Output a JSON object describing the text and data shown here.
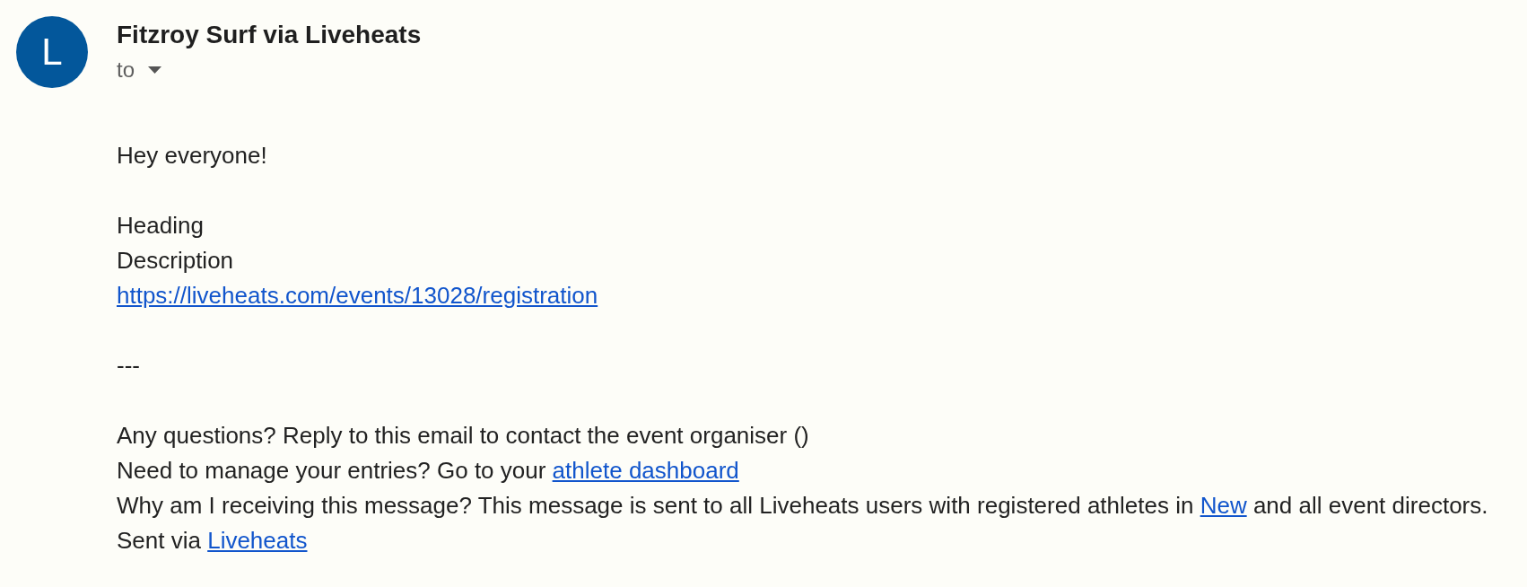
{
  "message": {
    "sender": {
      "avatar_letter": "L",
      "name": "Fitzroy Surf via Liveheats"
    },
    "recipient_label": "to",
    "body": [
      {
        "lines": [
          {
            "parts": [
              {
                "kind": "text",
                "text": "Hey everyone!"
              }
            ]
          }
        ]
      },
      {
        "lines": [
          {
            "parts": [
              {
                "kind": "text",
                "text": "Heading"
              }
            ]
          },
          {
            "parts": [
              {
                "kind": "text",
                "text": "Description"
              }
            ]
          },
          {
            "parts": [
              {
                "kind": "link",
                "text": "https://liveheats.com/events/13028/registration"
              }
            ]
          }
        ]
      },
      {
        "lines": [
          {
            "parts": [
              {
                "kind": "text",
                "text": "---"
              }
            ]
          }
        ]
      },
      {
        "lines": [
          {
            "parts": [
              {
                "kind": "text",
                "text": "Any questions? Reply to this email to contact the event organiser ()"
              }
            ]
          },
          {
            "parts": [
              {
                "kind": "text",
                "text": "Need to manage your entries? Go to your "
              },
              {
                "kind": "link",
                "text": "athlete dashboard"
              }
            ]
          },
          {
            "parts": [
              {
                "kind": "text",
                "text": "Why am I receiving this message? This message is sent to all Liveheats users with registered athletes in "
              },
              {
                "kind": "link",
                "text": "New"
              },
              {
                "kind": "text",
                "text": " and all event directors."
              }
            ]
          },
          {
            "parts": [
              {
                "kind": "text",
                "text": "Sent via "
              },
              {
                "kind": "link",
                "text": "Liveheats"
              }
            ]
          }
        ]
      }
    ]
  }
}
